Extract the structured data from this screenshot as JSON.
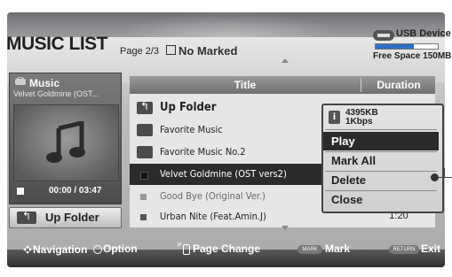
{
  "header": {
    "title": "MUSIC LIST",
    "page_info": "Page 2/3",
    "marked_label": "No Marked"
  },
  "device": {
    "name": "USB Device",
    "free_space": "Free Space 150MB",
    "usage_fraction": 0.62,
    "bar_color": "#2a6fc4"
  },
  "now_playing": {
    "category": "Music",
    "track": "Velvet Goldmine (OST...",
    "time": "00:00 / 03:47",
    "icon": "music-note-icon"
  },
  "side_button": {
    "label": "Up Folder"
  },
  "table": {
    "columns": [
      "Title",
      "Duration"
    ],
    "rows": [
      {
        "type": "up-folder",
        "title": "Up Folder",
        "duration": ""
      },
      {
        "type": "folder",
        "title": "Favorite Music",
        "duration": ""
      },
      {
        "type": "folder",
        "title": "Favorite Music No.2",
        "duration": ""
      },
      {
        "type": "track",
        "title": "Velvet Goldmine (OST vers2)",
        "duration": "",
        "selected": true
      },
      {
        "type": "track",
        "title": "Good Bye (Original Ver.)",
        "duration": "",
        "dimmed": true
      },
      {
        "type": "track",
        "title": "Urban Nite (Feat.Amin.J)",
        "duration": "1:20"
      }
    ]
  },
  "popup": {
    "file_size": "4395KB",
    "bitrate": "1Kbps",
    "items": [
      "Play",
      "Mark All",
      "Delete",
      "Close"
    ],
    "active_index": 0
  },
  "footer": {
    "navigation": "Navigation",
    "option": "Option",
    "page_change": "Page Change",
    "mark_badge": "MARK",
    "mark": "Mark",
    "return_badge": "RETURN",
    "exit": "Exit"
  }
}
